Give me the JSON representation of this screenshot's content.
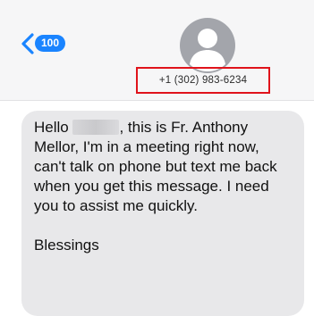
{
  "colors": {
    "accent": "#1a84ff",
    "highlight": "#e0131b",
    "bubble": "#e8e8ea",
    "avatar": "#a3a5ab"
  },
  "header": {
    "back_icon": "chevron-left-icon",
    "unread_count": "100",
    "avatar_icon": "person-silhouette-icon",
    "phone_number": "+1 (302) 983-6234"
  },
  "message": {
    "greeting": "Hello",
    "line1": ", this is Fr. Anthony Mellor, I'm in a meeting right now, can't talk on phone but text me back when you get this message. I need you to assist me quickly.",
    "closing": "Blessings"
  }
}
